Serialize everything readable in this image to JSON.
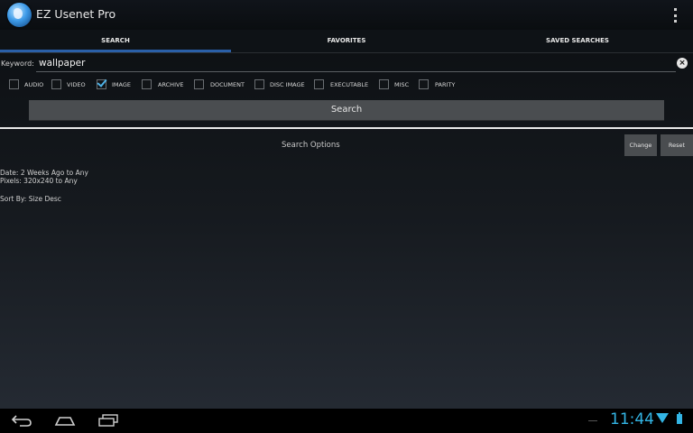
{
  "app": {
    "title": "EZ Usenet Pro"
  },
  "tabs": [
    {
      "label": "SEARCH",
      "active": true
    },
    {
      "label": "FAVORITES",
      "active": false
    },
    {
      "label": "SAVED SEARCHES",
      "active": false
    }
  ],
  "keyword": {
    "label": "Keyword:",
    "value": "wallpaper"
  },
  "categories": [
    {
      "label": "AUDIO",
      "checked": false
    },
    {
      "label": "VIDEO",
      "checked": false
    },
    {
      "label": "IMAGE",
      "checked": true
    },
    {
      "label": "ARCHIVE",
      "checked": false
    },
    {
      "label": "DOCUMENT",
      "checked": false
    },
    {
      "label": "DISC IMAGE",
      "checked": false
    },
    {
      "label": "EXECUTABLE",
      "checked": false
    },
    {
      "label": "MISC",
      "checked": false
    },
    {
      "label": "PARITY",
      "checked": false
    }
  ],
  "search_button": "Search",
  "options": {
    "title": "Search Options",
    "change_label": "Change",
    "reset_label": "Reset",
    "date": "Date: 2 Weeks Ago to Any",
    "pixels": "Pixels: 320x240 to Any",
    "sort": "Sort By: Size Desc"
  },
  "system": {
    "clock": "11:44",
    "accent": "#33b5e5"
  },
  "icons": [
    "app-globe-icon",
    "overflow-menu-icon",
    "clear-icon",
    "back-icon",
    "home-icon",
    "recents-icon",
    "wifi-icon",
    "battery-icon"
  ]
}
